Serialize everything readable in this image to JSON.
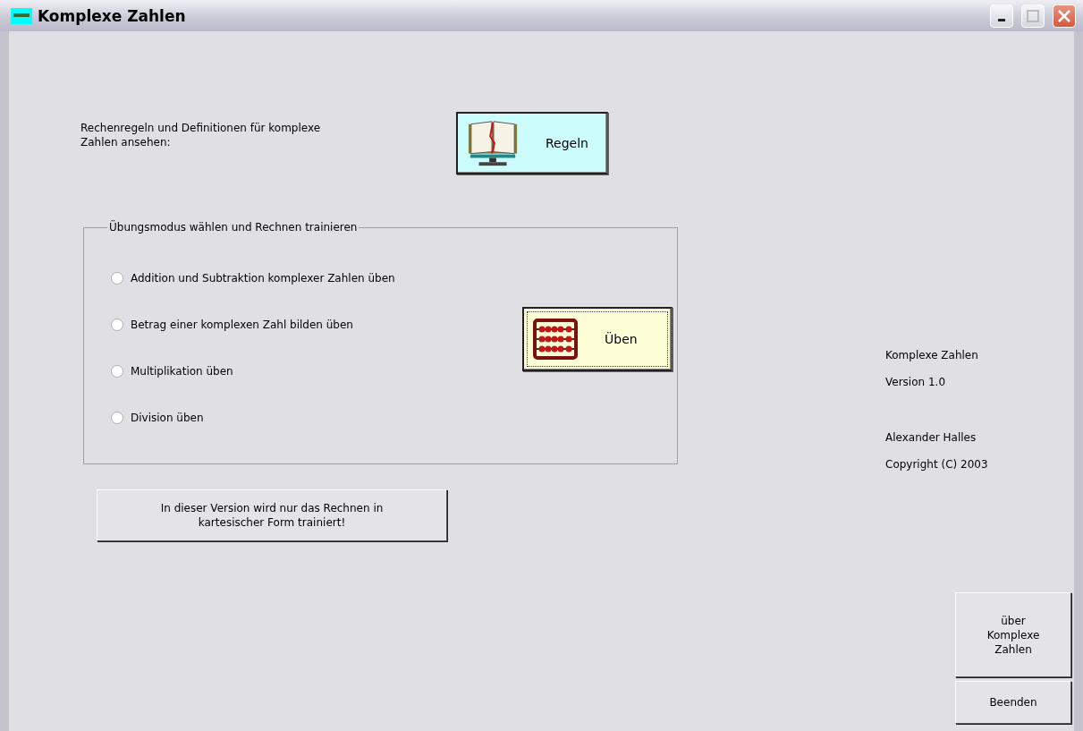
{
  "window": {
    "title": "Komplexe Zahlen"
  },
  "rules": {
    "label": "Rechenregeln und Definitionen für komplexe Zahlen ansehen:",
    "button": "Regeln"
  },
  "exercise_group": {
    "title": "Übungsmodus wählen und Rechnen trainieren",
    "options": [
      {
        "label": "Addition und Subtraktion komplexer Zahlen üben",
        "selected": false
      },
      {
        "label": "Betrag einer komplexen Zahl bilden üben",
        "selected": false
      },
      {
        "label": "Multiplikation üben",
        "selected": false
      },
      {
        "label": "Division üben",
        "selected": false
      }
    ],
    "button": "Üben"
  },
  "note_button": "In dieser Version wird nur das Rechnen in kartesischer Form trainiert!",
  "info": [
    "Komplexe Zahlen",
    "Version 1.0",
    "Alexander Halles",
    "Copyright (C) 2003"
  ],
  "buttons": [
    "über Komplexe Zahlen",
    "Beenden"
  ]
}
